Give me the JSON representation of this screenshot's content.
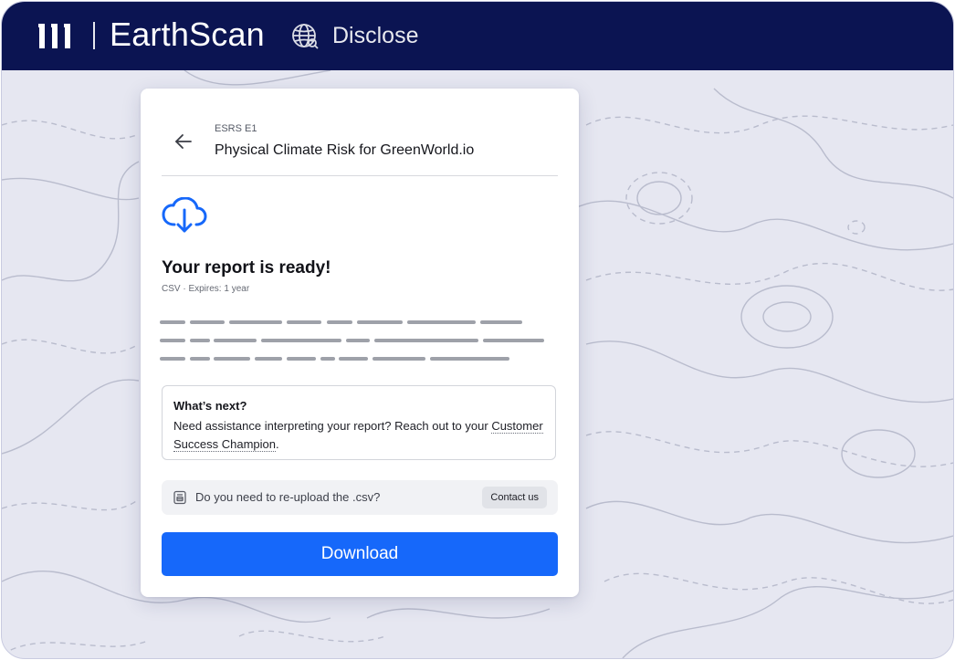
{
  "header": {
    "brand": "EarthScan",
    "product": "Disclose",
    "background": "#0b1452"
  },
  "card": {
    "breadcrumb": "ESRS E1",
    "title": "Physical Climate Risk for GreenWorld.io",
    "status_title": "Your report is ready!",
    "meta": "CSV · Expires: 1 year",
    "info": {
      "heading": "What’s next?",
      "body_prefix": "Need assistance interpreting your report? Reach out to your ",
      "link_text": "Customer Success Champion",
      "body_suffix": "."
    },
    "reupload": {
      "question": "Do you need to re-upload the .csv?",
      "button_label": "Contact us"
    },
    "download_label": "Download"
  },
  "icons": {
    "logo": "earthscan-logo-icon",
    "globe": "globe-icon",
    "back": "arrow-left-icon",
    "cloud": "cloud-download-icon",
    "document": "document-icon"
  },
  "colors": {
    "accent": "#1668fa",
    "page_bg": "#e6e7f1"
  }
}
